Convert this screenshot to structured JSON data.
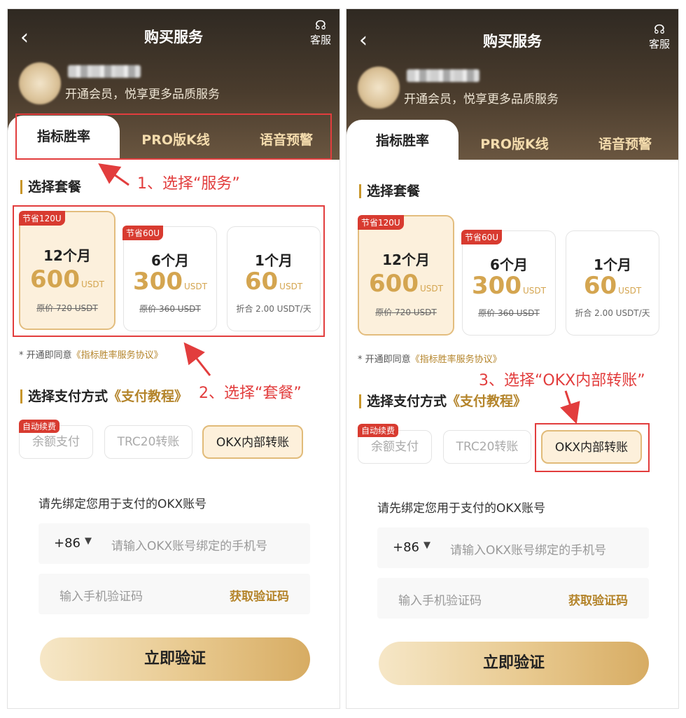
{
  "header": {
    "back_icon": "‹",
    "title": "购买服务",
    "customer_service": "客服",
    "slogan": "开通会员，悦享更多品质服务"
  },
  "tabs": [
    "指标胜率",
    "PRO版K线",
    "语音预警"
  ],
  "active_tab": "指标胜率",
  "plan_section_title": "选择套餐",
  "plans": [
    {
      "badge": "节省120U",
      "months": "12个月",
      "price": "600",
      "unit": "USDT",
      "note": "原价 720 USDT"
    },
    {
      "badge": "节省60U",
      "months": "6个月",
      "price": "300",
      "unit": "USDT",
      "note": "原价 360 USDT"
    },
    {
      "badge": "",
      "months": "1个月",
      "price": "60",
      "unit": "USDT",
      "note": "折合 2.00 USDT/天"
    }
  ],
  "agreement": {
    "prefix": "* 开通即同意",
    "link": "《指标胜率服务协议》"
  },
  "payment_section": {
    "title": "选择支付方式",
    "link": "《支付教程》"
  },
  "payment_methods": [
    "余额支付",
    "TRC20转账",
    "OKX内部转账"
  ],
  "auto_renew_badge": "自动续费",
  "bind": {
    "tip": "请先绑定您用于支付的OKX账号",
    "country_code": "+86",
    "phone_placeholder": "请输入OKX账号绑定的手机号",
    "code_placeholder": "输入手机验证码",
    "get_code": "获取验证码"
  },
  "verify_button": "立即验证",
  "annotations": {
    "step1": "1、选择“服务”",
    "step2": "2、选择“套餐”",
    "step3": "3、选择“OKX内部转账”"
  },
  "colors": {
    "accent_gold": "#d4a550",
    "link_gold": "#b4842a",
    "badge_red": "#d83b30",
    "annotation_red": "#e23d3d"
  }
}
